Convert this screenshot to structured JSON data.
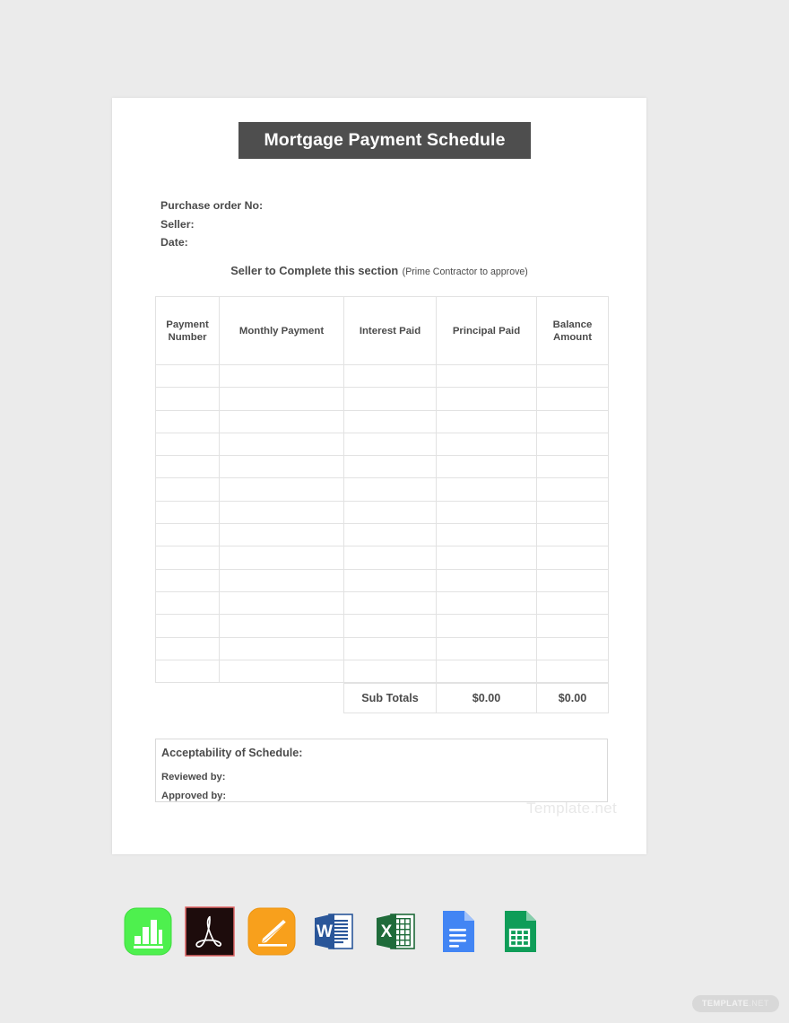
{
  "document": {
    "title": "Mortgage Payment Schedule",
    "meta_fields": [
      "Purchase order No:",
      "Seller:",
      "Date:"
    ],
    "section_note": {
      "strong": "Seller to Complete this section",
      "paren": "(Prime Contractor to approve)"
    },
    "table": {
      "headers": [
        "Payment Number",
        "Monthly Payment",
        "Interest Paid",
        "Principal Paid",
        "Balance Amount"
      ],
      "empty_row_count": 14,
      "rows": []
    },
    "subtotals": {
      "label": "Sub Totals",
      "interest_paid": "$0.00",
      "balance_amount": "$0.00"
    },
    "acceptability": {
      "title": "Acceptability of Schedule:",
      "lines": [
        "Reviewed by:",
        "Approved by:"
      ]
    },
    "watermark": "Template.net"
  },
  "formats": [
    {
      "name": "apple-numbers",
      "label": "Apple Numbers"
    },
    {
      "name": "pdf",
      "label": "PDF"
    },
    {
      "name": "apple-pages",
      "label": "Apple Pages"
    },
    {
      "name": "ms-word",
      "label": "MS Word"
    },
    {
      "name": "ms-excel",
      "label": "MS Excel"
    },
    {
      "name": "google-docs",
      "label": "Google Docs"
    },
    {
      "name": "google-sheets",
      "label": "Google Sheets"
    }
  ],
  "badge": {
    "prefix": "TEMPLATE",
    "suffix": ".NET"
  },
  "colors": {
    "page_background": "#ebebeb",
    "title_bar": "#4e4e4e",
    "text": "#4b4b4b",
    "table_border": "#e2e2e2",
    "watermark": "#e8e8e8"
  }
}
